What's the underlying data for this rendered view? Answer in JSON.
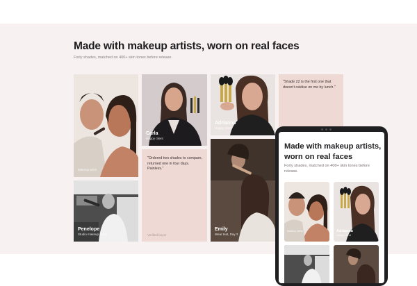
{
  "section": {
    "title": "Made with makeup artists, worn on real faces",
    "subtitle": "Forty shades, matched on 400+ skin tones before release."
  },
  "tiles": {
    "artist_couple": {
      "name": "",
      "role": "Makeup artist"
    },
    "carla": {
      "name": "Carla",
      "role": "Happy client"
    },
    "adrianna": {
      "name": "Adrianna",
      "role": "Happy client"
    },
    "penelope": {
      "name": "Penelope",
      "role": "Studio makeup artist"
    },
    "emily": {
      "name": "Emily",
      "role": "Wear test, Day 3"
    },
    "quote_shade": {
      "text": "\"Shade 22 is the first one that doesn't oxidise on me by lunch.\""
    },
    "quote_order": {
      "text": "\"Ordered two shades to compare, returned one in four days. Painless.\"",
      "who": "Verified buyer"
    }
  },
  "tablet": {
    "title": "Made with makeup artists, worn on real faces",
    "subtitle": "Forty shades, matched on 400+ skin tones before release.",
    "tiles": [
      {
        "name": "",
        "role": "Makeup artist"
      },
      {
        "name": "Adrianna",
        "role": "Happy client"
      }
    ]
  },
  "colors": {
    "band": "#f8f1f1",
    "quote_tile": "#efd9d5",
    "tablet_frame": "#1f1f21"
  }
}
